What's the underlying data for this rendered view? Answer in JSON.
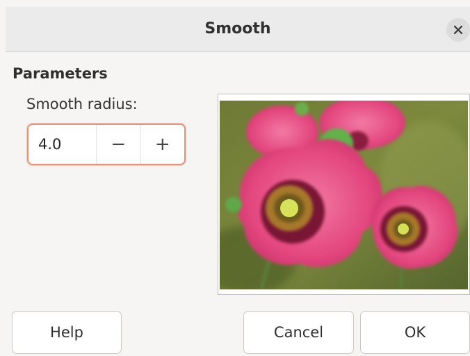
{
  "window": {
    "title": "Smooth",
    "close_icon": "close-icon"
  },
  "parameters": {
    "section_title": "Parameters",
    "radius_label": "Smooth radius:",
    "radius_value": "4.0",
    "decrement_label": "−",
    "increment_label": "+"
  },
  "preview": {
    "image_subject": "pink-poppy-flowers-photo"
  },
  "buttons": {
    "help": "Help",
    "cancel": "Cancel",
    "ok": "OK"
  },
  "colors": {
    "focus_border": "#e4957c",
    "titlebar_bg": "#ebebeb",
    "dialog_bg": "#f6f5f4"
  }
}
